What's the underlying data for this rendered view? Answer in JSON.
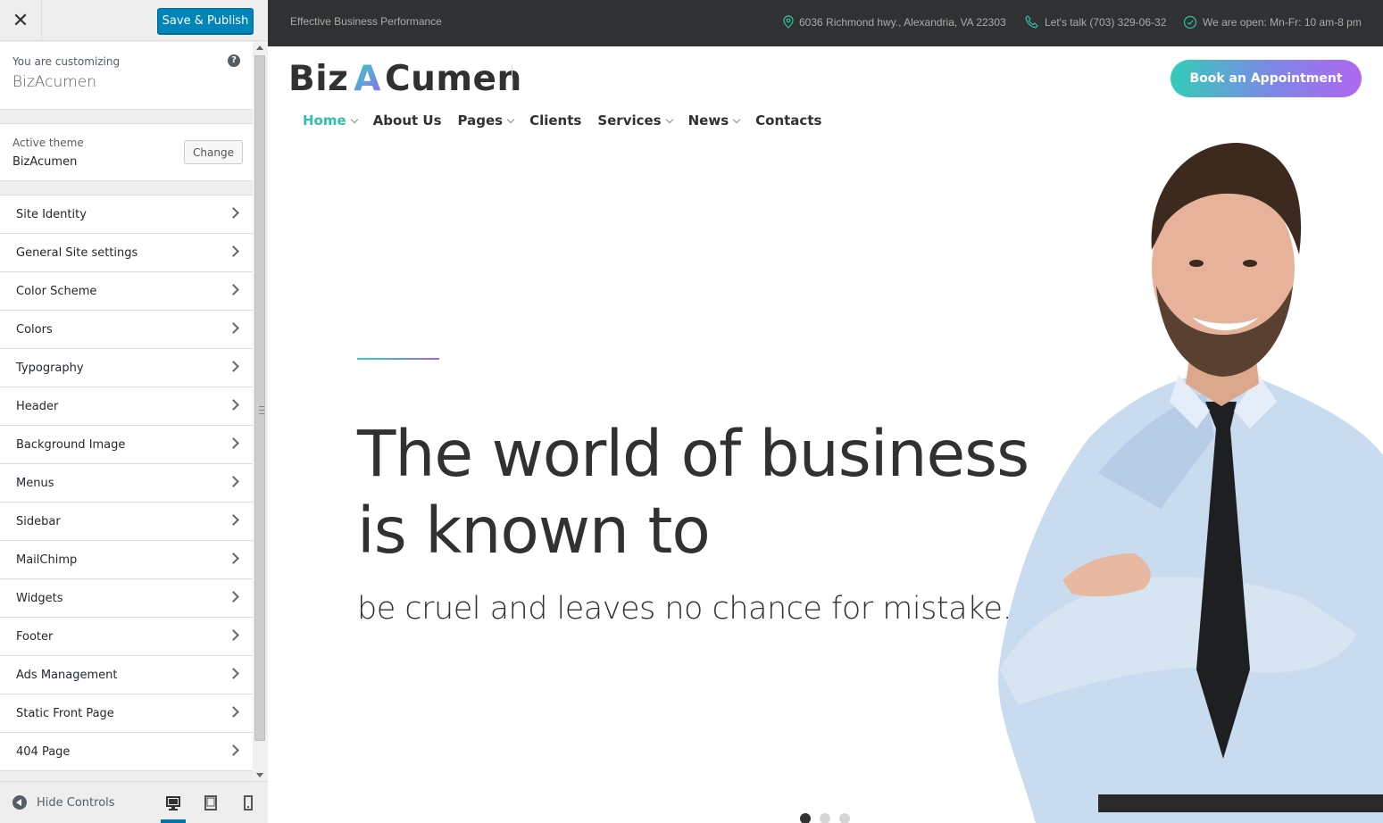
{
  "customizer": {
    "close_label": "✕",
    "save_label": "Save & Publish",
    "info": {
      "customizing_label": "You are customizing",
      "site_name": "BizAcumen",
      "help_label": "?"
    },
    "theme": {
      "active_label": "Active theme",
      "name": "BizAcumen",
      "change_label": "Change"
    },
    "panels": [
      {
        "label": "Site Identity"
      },
      {
        "label": "General Site settings"
      },
      {
        "label": "Color Scheme"
      },
      {
        "label": "Colors"
      },
      {
        "label": "Typography"
      },
      {
        "label": "Header"
      },
      {
        "label": "Background Image"
      },
      {
        "label": "Menus"
      },
      {
        "label": "Sidebar"
      },
      {
        "label": "MailChimp"
      },
      {
        "label": "Widgets"
      },
      {
        "label": "Footer"
      },
      {
        "label": "Ads Management"
      },
      {
        "label": "Static Front Page"
      },
      {
        "label": "404 Page"
      }
    ],
    "footer": {
      "hide_label": "Hide Controls",
      "active_device": "desktop"
    },
    "colors": {
      "primary_button": "#0085ba",
      "active_device": "#0073aa"
    }
  },
  "site": {
    "topbar": {
      "tagline": "Effective Business Performance",
      "address": "6036 Richmond hwy., Alexandria, VA 22303",
      "phone": "Let's talk (703) 329-06-32",
      "hours": "We are open: Mn-Fr: 10 am-8 pm"
    },
    "logo": {
      "part1": "Biz",
      "part2": "A",
      "part3": "Cumen"
    },
    "cta_label": "Book an Appointment",
    "nav": {
      "home": "Home",
      "about": "About Us",
      "pages": "Pages",
      "clients": "Clients",
      "services": "Services",
      "news": "News",
      "contacts": "Contacts"
    },
    "hero": {
      "title_line1": "The world of business",
      "title_line2": "is known to",
      "subtitle": "be cruel and leaves no chance for mistake."
    },
    "slider": {
      "count": 3,
      "active": 1
    },
    "colors": {
      "accent": "#2ec3a8",
      "gradient_start": "#2ad5c1",
      "gradient_end": "#9b66f0",
      "dark": "#2f3132"
    }
  }
}
